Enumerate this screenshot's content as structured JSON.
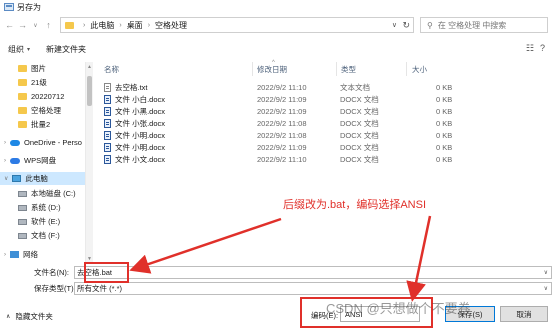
{
  "window": {
    "title": "另存为"
  },
  "address": {
    "breadcrumbs": [
      "此电脑",
      "桌面",
      "空格处理"
    ],
    "search_placeholder": "在 空格处理 中搜索"
  },
  "toolbar": {
    "organize_label": "组织",
    "new_folder_label": "新建文件夹"
  },
  "nav": {
    "items": [
      {
        "label": "图片",
        "icon": "folder-icon",
        "pinned": true
      },
      {
        "label": "21级",
        "icon": "folder-icon"
      },
      {
        "label": "20220712",
        "icon": "folder-icon"
      },
      {
        "label": "空格处理",
        "icon": "folder-icon"
      },
      {
        "label": "批量2",
        "icon": "folder-icon"
      },
      {
        "label": "OneDrive - Perso",
        "icon": "onedrive-icon"
      },
      {
        "label": "WPS网盘",
        "icon": "wps-cloud-icon"
      },
      {
        "label": "此电脑",
        "icon": "pc-icon"
      },
      {
        "label": "本地磁盘 (C:)",
        "icon": "drive-icon"
      },
      {
        "label": "系统 (D:)",
        "icon": "drive-icon"
      },
      {
        "label": "软件 (E:)",
        "icon": "drive-icon"
      },
      {
        "label": "文档 (F:)",
        "icon": "drive-icon"
      },
      {
        "label": "网络",
        "icon": "network-icon"
      }
    ]
  },
  "files": {
    "columns": [
      "名称",
      "修改日期",
      "类型",
      "大小"
    ],
    "rows": [
      {
        "name": "去空格.txt",
        "date": "2022/9/2 11:10",
        "type": "文本文档",
        "size": "0 KB",
        "icon": "text-file-icon"
      },
      {
        "name": "文件 小白.docx",
        "date": "2022/9/2 11:09",
        "type": "DOCX 文档",
        "size": "0 KB",
        "icon": "docx-file-icon"
      },
      {
        "name": "文件 小黑.docx",
        "date": "2022/9/2 11:09",
        "type": "DOCX 文档",
        "size": "0 KB",
        "icon": "docx-file-icon"
      },
      {
        "name": "文件 小张.docx",
        "date": "2022/9/2 11:08",
        "type": "DOCX 文档",
        "size": "0 KB",
        "icon": "docx-file-icon"
      },
      {
        "name": "文件 小明.docx",
        "date": "2022/9/2 11:08",
        "type": "DOCX 文档",
        "size": "0 KB",
        "icon": "docx-file-icon"
      },
      {
        "name": "文件 小明.docx",
        "date": "2022/9/2 11:09",
        "type": "DOCX 文档",
        "size": "0 KB",
        "icon": "docx-file-icon"
      },
      {
        "name": "文件 小文.docx",
        "date": "2022/9/2 11:10",
        "type": "DOCX 文档",
        "size": "0 KB",
        "icon": "docx-file-icon"
      }
    ]
  },
  "annotation": {
    "text": "后缀改为.bat，编码选择ANSI",
    "color": "#e0302a"
  },
  "form": {
    "filename_label": "文件名(N):",
    "filename_value": "去空格.bat",
    "filetype_label": "保存类型(T):",
    "filetype_value": "所有文件 (*.*)"
  },
  "footer": {
    "hide_folders_label": "隐藏文件夹",
    "encoding_label": "编码(E):",
    "encoding_value": "ANSI",
    "save_label": "保存(S)",
    "cancel_label": "取消"
  },
  "watermark": {
    "text": "CSDN @只想做个不要卷"
  }
}
